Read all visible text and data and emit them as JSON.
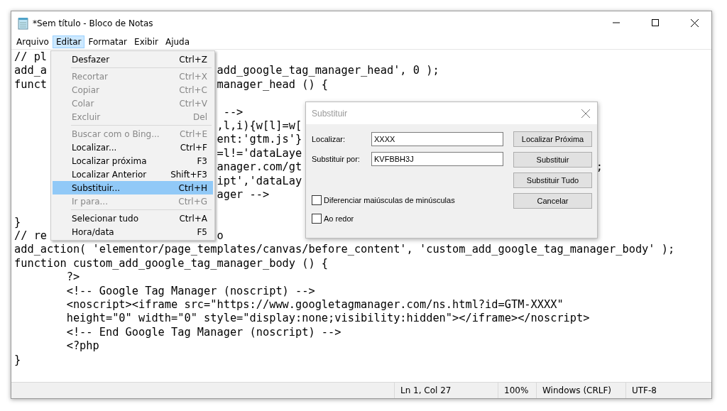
{
  "window": {
    "title": "*Sem título - Bloco de Notas"
  },
  "menu_bar": [
    {
      "label": "Arquivo",
      "selected": false
    },
    {
      "label": "Editar",
      "selected": true
    },
    {
      "label": "Formatar",
      "selected": false
    },
    {
      "label": "Exibir",
      "selected": false
    },
    {
      "label": "Ajuda",
      "selected": false
    }
  ],
  "editor_lines": [
    {
      "left": "// pl"
    },
    {
      "left": "add_a",
      "mid": "add_google_tag_manager_head', 0 );"
    },
    {
      "left": "funct",
      "mid": "manager_head () {"
    },
    {
      "mid": " -->"
    },
    {
      "mid": ",l,i){w[l]=w["
    },
    {
      "mid": "ent:'gtm.js'}"
    },
    {
      "mid": "=l!='dataLaye"
    },
    {
      "mid": "anager.com/gt",
      "far": ";"
    },
    {
      "mid": "ipt','dataLay"
    },
    {
      "mid": "ager -->"
    },
    {
      "left": "}"
    },
    {
      "left": "// re",
      "mid": "o"
    },
    {
      "left": "add_action( 'elementor/page_templates/canvas/before_content', 'custom_add_google_tag_manager_body' );"
    },
    {
      "left": "function custom_add_google_tag_manager_body () {"
    },
    {
      "left": "        ?>"
    },
    {
      "left": "        <!-- Google Tag Manager (noscript) -->"
    },
    {
      "left": "        <noscript><iframe src=\"https://www.googletagmanager.com/ns.html?id=GTM-XXXX\""
    },
    {
      "left": "        height=\"0\" width=\"0\" style=\"display:none;visibility:hidden\"></iframe></noscript>"
    },
    {
      "left": "        <!-- End Google Tag Manager (noscript) -->"
    },
    {
      "left": "        <?php"
    },
    {
      "left": "}"
    }
  ],
  "edit_menu": [
    {
      "kind": "item",
      "label": "Desfazer",
      "shortcut": "Ctrl+Z",
      "disabled": false,
      "selected": false
    },
    {
      "kind": "separator"
    },
    {
      "kind": "item",
      "label": "Recortar",
      "shortcut": "Ctrl+X",
      "disabled": true,
      "selected": false
    },
    {
      "kind": "item",
      "label": "Copiar",
      "shortcut": "Ctrl+C",
      "disabled": true,
      "selected": false
    },
    {
      "kind": "item",
      "label": "Colar",
      "shortcut": "Ctrl+V",
      "disabled": true,
      "selected": false
    },
    {
      "kind": "item",
      "label": "Excluir",
      "shortcut": "Del",
      "disabled": true,
      "selected": false
    },
    {
      "kind": "separator"
    },
    {
      "kind": "item",
      "label": "Buscar com o Bing...",
      "shortcut": "Ctrl+E",
      "disabled": true,
      "selected": false
    },
    {
      "kind": "item",
      "label": "Localizar...",
      "shortcut": "Ctrl+F",
      "disabled": false,
      "selected": false
    },
    {
      "kind": "item",
      "label": "Localizar próxima",
      "shortcut": "F3",
      "disabled": false,
      "selected": false
    },
    {
      "kind": "item",
      "label": "Localizar Anterior",
      "shortcut": "Shift+F3",
      "disabled": false,
      "selected": false
    },
    {
      "kind": "item",
      "label": "Substituir...",
      "shortcut": "Ctrl+H",
      "disabled": false,
      "selected": true
    },
    {
      "kind": "item",
      "label": "Ir para...",
      "shortcut": "Ctrl+G",
      "disabled": true,
      "selected": false
    },
    {
      "kind": "separator"
    },
    {
      "kind": "item",
      "label": "Selecionar tudo",
      "shortcut": "Ctrl+A",
      "disabled": false,
      "selected": false
    },
    {
      "kind": "item",
      "label": "Hora/data",
      "shortcut": "F5",
      "disabled": false,
      "selected": false
    }
  ],
  "replace_dialog": {
    "title": "Substituir",
    "fields": [
      {
        "label": "Localizar:",
        "value": "XXXX"
      },
      {
        "label": "Substituir por:",
        "value": "KVFBBH3J"
      }
    ],
    "buttons": [
      "Localizar Próxima",
      "Substituir",
      "Substituir Tudo",
      "Cancelar"
    ],
    "options": [
      {
        "label": "Diferenciar maiúsculas de minúsculas",
        "checked": false
      },
      {
        "label": "Ao redor",
        "checked": false
      }
    ]
  },
  "status_bar": [
    "Ln 1, Col 27",
    "100%",
    "Windows (CRLF)",
    "UTF-8"
  ]
}
